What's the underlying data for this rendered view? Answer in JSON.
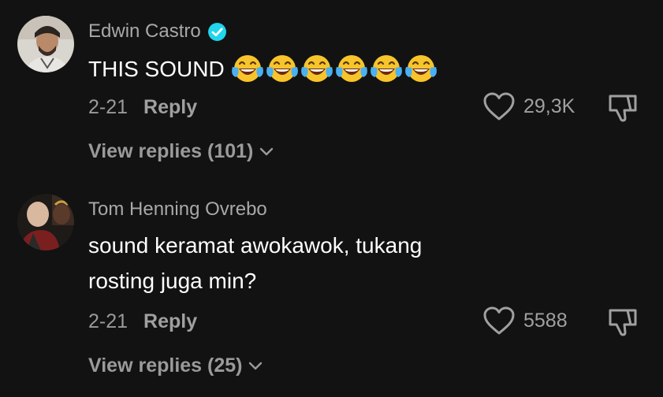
{
  "colors": {
    "background": "#121212",
    "primary_text": "#ffffff",
    "secondary_text": "#a8a8a8",
    "verified_badge": "#20d5ec"
  },
  "comments": [
    {
      "username": "Edwin Castro",
      "verified": true,
      "text": "THIS SOUND",
      "emoji_icon": "face-with-tears-of-joy-icon",
      "emoji_count": 6,
      "date": "2-21",
      "reply_label": "Reply",
      "likes": "29,3K",
      "view_replies": "View replies (101)"
    },
    {
      "username": "Tom Henning Ovrebo",
      "verified": false,
      "text_lines": [
        "sound keramat awokawok, tukang",
        "rosting juga min?"
      ],
      "date": "2-21",
      "reply_label": "Reply",
      "likes": "5588",
      "view_replies": "View replies (25)"
    }
  ]
}
